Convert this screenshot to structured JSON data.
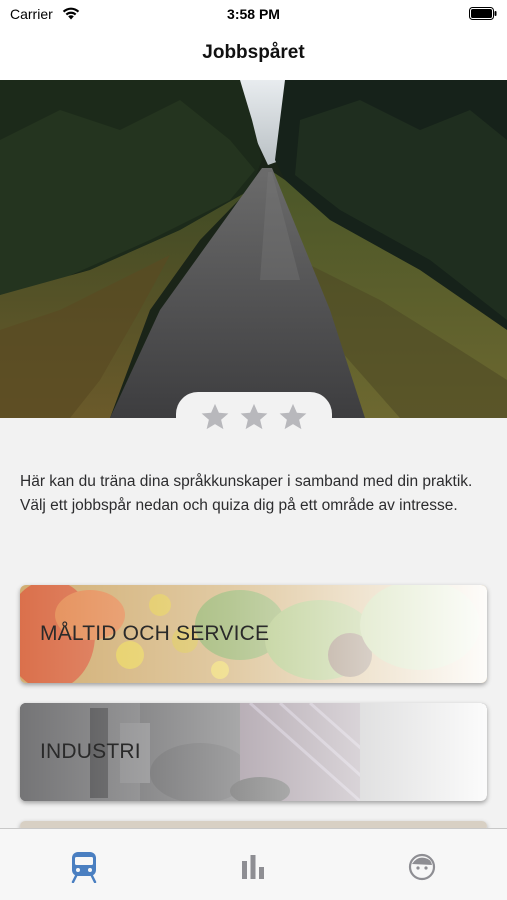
{
  "status_bar": {
    "carrier": "Carrier",
    "time": "3:58 PM"
  },
  "nav": {
    "title": "Jobbspåret"
  },
  "rating": {
    "stars_filled": 0,
    "stars_total": 3
  },
  "intro_text": "Här kan du träna dina språkkunskaper i samband med din praktik. Välj ett jobbspår nedan och quiza dig på ett område av intresse.",
  "tracks": [
    {
      "label": "MÅLTID OCH SERVICE",
      "icon": "food-image"
    },
    {
      "label": "INDUSTRI",
      "icon": "industry-image"
    }
  ],
  "tab_bar": {
    "items": [
      {
        "icon": "train-icon",
        "active": true
      },
      {
        "icon": "bar-chart-icon",
        "active": false
      },
      {
        "icon": "face-icon",
        "active": false
      }
    ]
  },
  "colors": {
    "accent": "#4a7fc1",
    "inactive": "#8e8e93",
    "star": "#b8b8bc"
  }
}
